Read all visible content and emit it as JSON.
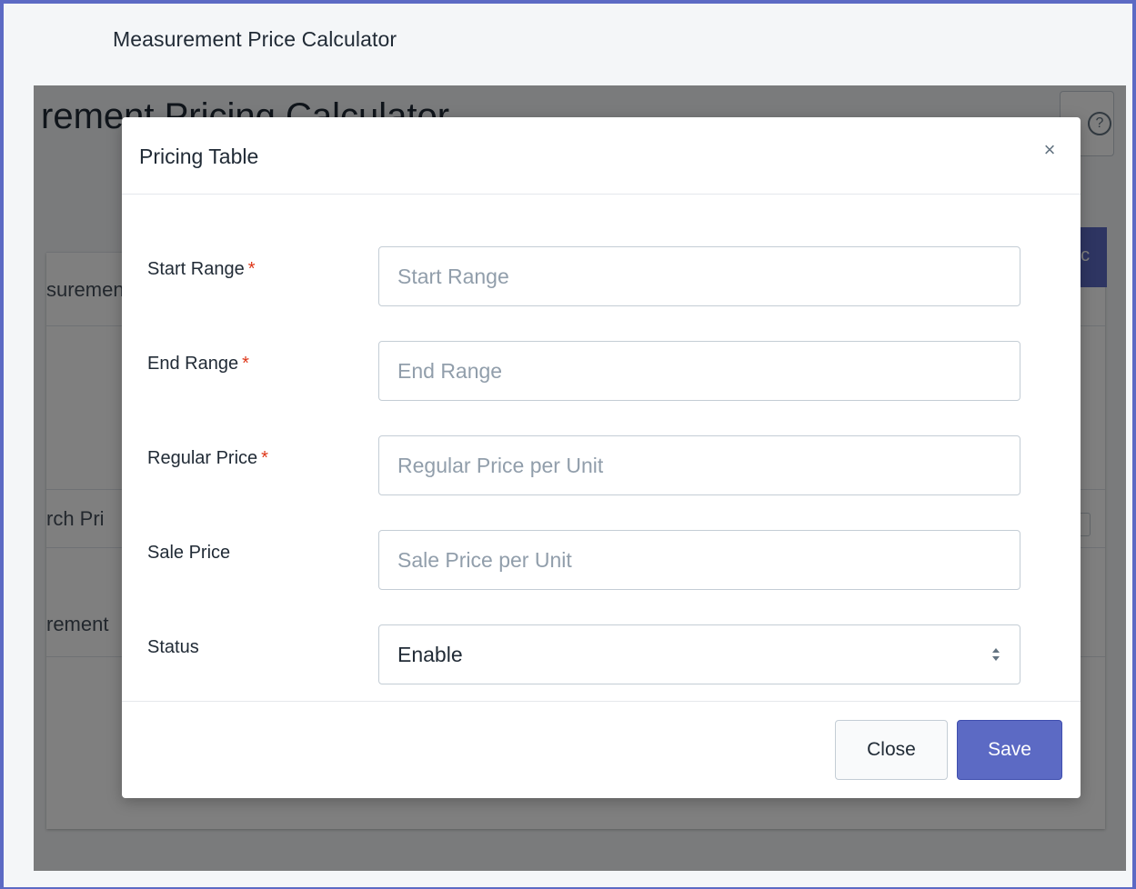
{
  "app": {
    "title": "Measurement Price Calculator"
  },
  "background": {
    "heading_fragment": "rement Pricing Calculator",
    "row1_fragment": "suremen",
    "button_fragment": "ric",
    "search_fragment": "rch Pri",
    "row3_fragment": "rement"
  },
  "modal": {
    "title": "Pricing Table",
    "close_icon": "×",
    "fields": [
      {
        "label": "Start Range",
        "required": "*",
        "placeholder": "Start Range",
        "value": ""
      },
      {
        "label": "End Range",
        "required": "*",
        "placeholder": "End Range",
        "value": ""
      },
      {
        "label": "Regular Price",
        "required": "*",
        "placeholder": "Regular Price per Unit",
        "value": ""
      },
      {
        "label": "Sale Price",
        "required": "",
        "placeholder": "Sale Price per Unit",
        "value": ""
      }
    ],
    "status": {
      "label": "Status",
      "selected": "Enable"
    },
    "buttons": {
      "close": "Close",
      "save": "Save"
    }
  },
  "colors": {
    "accent": "#5c6ac4",
    "required": "#de3618"
  },
  "icons": {
    "modal_close": "close-icon",
    "select_arrows": "chevron-updown-icon",
    "help": "help-icon"
  }
}
